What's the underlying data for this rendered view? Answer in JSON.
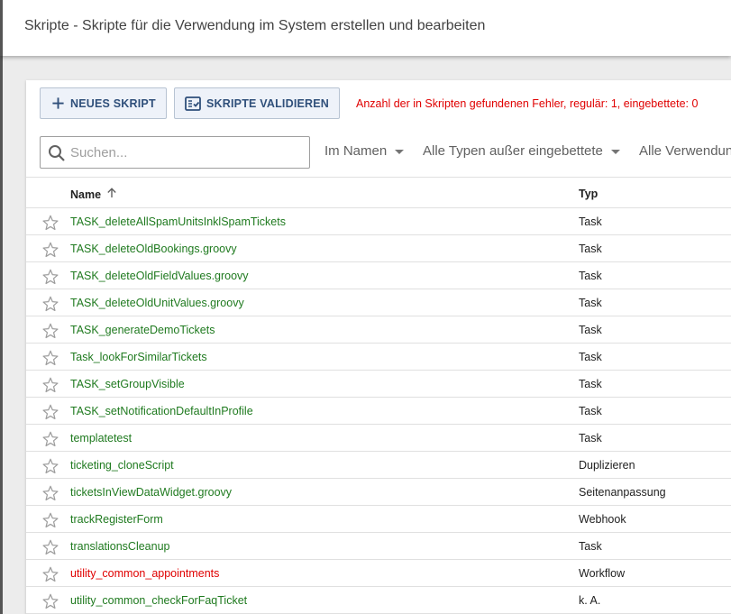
{
  "header": {
    "title": "Skripte - Skripte für die Verwendung im System erstellen und bearbeiten"
  },
  "toolbar": {
    "new_script_label": "NEUES SKRIPT",
    "validate_label": "SKRIPTE VALIDIEREN",
    "error_summary": "Anzahl der in Skripten gefundenen Fehler, regulär: 1, eingebettete: 0"
  },
  "filters": {
    "search_placeholder": "Suchen...",
    "search_value": "",
    "in_name": "Im Namen",
    "types": "Alle Typen außer eingebettete",
    "usage": "Alle Verwendungen"
  },
  "table": {
    "headers": {
      "name": "Name",
      "typ": "Typ"
    },
    "sort": "name-ascending",
    "rows": [
      {
        "name": "TASK_deleteAllSpamUnitsInklSpamTickets",
        "typ": "Task",
        "status": "ok"
      },
      {
        "name": "TASK_deleteOldBookings.groovy",
        "typ": "Task",
        "status": "ok"
      },
      {
        "name": "TASK_deleteOldFieldValues.groovy",
        "typ": "Task",
        "status": "ok"
      },
      {
        "name": "TASK_deleteOldUnitValues.groovy",
        "typ": "Task",
        "status": "ok"
      },
      {
        "name": "TASK_generateDemoTickets",
        "typ": "Task",
        "status": "ok"
      },
      {
        "name": "Task_lookForSimilarTickets",
        "typ": "Task",
        "status": "ok"
      },
      {
        "name": "TASK_setGroupVisible",
        "typ": "Task",
        "status": "ok"
      },
      {
        "name": "TASK_setNotificationDefaultInProfile",
        "typ": "Task",
        "status": "ok"
      },
      {
        "name": "templatetest",
        "typ": "Task",
        "status": "ok"
      },
      {
        "name": "ticketing_cloneScript",
        "typ": "Duplizieren",
        "status": "ok"
      },
      {
        "name": "ticketsInViewDataWidget.groovy",
        "typ": "Seitenanpassung",
        "status": "ok"
      },
      {
        "name": "trackRegisterForm",
        "typ": "Webhook",
        "status": "ok"
      },
      {
        "name": "translationsCleanup",
        "typ": "Task",
        "status": "ok"
      },
      {
        "name": "utility_common_appointments",
        "typ": "Workflow",
        "status": "error"
      },
      {
        "name": "utility_common_checkForFaqTicket",
        "typ": "k. A.",
        "status": "ok"
      }
    ]
  },
  "colors": {
    "ok_name": "#1f7a1f",
    "error_name": "#e00000",
    "button_bg": "#eef2f9",
    "button_text": "#2f4f7a",
    "icons": [
      "plus-icon",
      "checklist-icon",
      "search-icon",
      "sort-arrow-up-icon",
      "star-outline-icon",
      "caret-down-icon"
    ]
  }
}
